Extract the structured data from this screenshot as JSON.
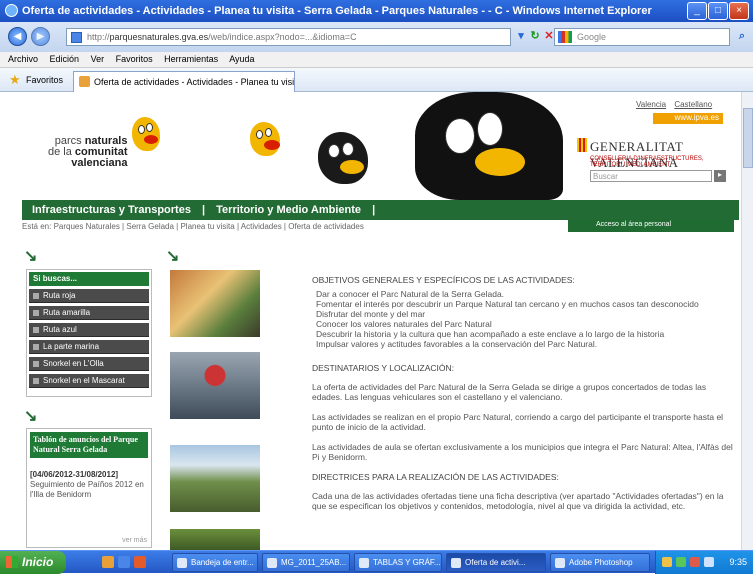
{
  "window": {
    "title": "Oferta de actividades - Actividades - Planea tu visita - Serra Gelada - Parques Naturales - - C - Windows Internet Explorer"
  },
  "address": {
    "url_host": "parquesnaturales.gva.es",
    "url_path": "/web/indice.aspx?nodo=...&idioma=C",
    "url_prefix": "http://",
    "search_placeholder": "Google"
  },
  "menu": [
    "Archivo",
    "Edición",
    "Ver",
    "Favoritos",
    "Herramientas",
    "Ayuda"
  ],
  "favorites": {
    "label": "Favoritos",
    "tab": "Oferta de actividades - Actividades - Planea tu visita -..."
  },
  "header": {
    "lang_valencia": "Valencia",
    "lang_castellano": "Castellano",
    "ipva": "www.ipva.es",
    "logo_line1": "parcs ",
    "logo_line1b": "naturals",
    "logo_line2": "de la ",
    "logo_line2b": "comunitat",
    "logo_line3": "valenciana",
    "gva_title": "GENERALITAT VALENCIANA",
    "gva_sub": "CONSELLERIA D'INFRAESTRUCTURES, TERRITORI I MEDI AMBIENT",
    "buscar": "Buscar"
  },
  "nav": {
    "item1": "Infraestructuras y Transportes",
    "sep": "|",
    "item2": "Territorio y Medio Ambiente"
  },
  "breadcrumb": "Está en:  Parques Naturales | Serra Gelada | Planea tu visita | Actividades | Oferta de actividades",
  "acceso": "Acceso al área personal",
  "sidebar": {
    "head": "Si buscas...",
    "items": [
      "Ruta roja",
      "Ruta amarilla",
      "Ruta azul",
      "La parte marina",
      "Snorkel en L'Olla",
      "Snorkel en el Mascarat"
    ]
  },
  "anuncios": {
    "head": "Tablón de anuncios del Parque Natural Serra Gelada",
    "date": "[04/06/2012-31/08/2012]",
    "text": "Seguimiento de Paíños 2012 en l'Illa de Benidorm",
    "more": "ver más"
  },
  "content": {
    "h1": "OBJETIVOS GENERALES Y ESPECÍFICOS DE LAS ACTIVIDADES:",
    "bullets": [
      "Dar a conocer el Parc Natural de la Serra Gelada.",
      "Fomentar el interés por descubrir un Parque Natural tan cercano y en muchos casos tan desconocido",
      "Disfrutar del monte y del mar",
      "Conocer los valores naturales del Parc Natural",
      "Descubrir la historia y la cultura que han acompañado a este enclave a lo largo de la historia",
      "Impulsar valores y actitudes favorables a la conservación del Parc Natural."
    ],
    "h2": "DESTINATARIOS Y LOCALIZACIÓN:",
    "p1": "La oferta de actividades del Parc Natural de la Serra Gelada se dirige a grupos concertados de todas las edades. Las lenguas vehiculares son el castellano y el valenciano.",
    "p2": "Las actividades se realizan en el propio Parc Natural, corriendo a cargo del participante el transporte hasta el punto de inicio de la actividad.",
    "p3": "Las actividades de aula se ofertan exclusivamente a los municipios que integra el Parc Natural: Altea, l'Alfàs del Pi y Benidorm.",
    "h3": "DIRECTRICES PARA LA REALIZACIÓN DE LAS ACTIVIDADES:",
    "p4": "Cada una de las actividades ofertadas tiene una ficha descriptiva (ver apartado \"Actividades ofertadas\") en la que se especifican los objetivos y contenidos, metodología, nivel al que va dirigida la actividad, etc."
  },
  "taskbar": {
    "start": "Inicio",
    "tasks": [
      "Bandeja de entr...",
      "MG_2011_25AB...",
      "TABLAS Y GRÁF...",
      "Oferta de activi...",
      "Adobe Photoshop"
    ],
    "clock": "9:35"
  }
}
